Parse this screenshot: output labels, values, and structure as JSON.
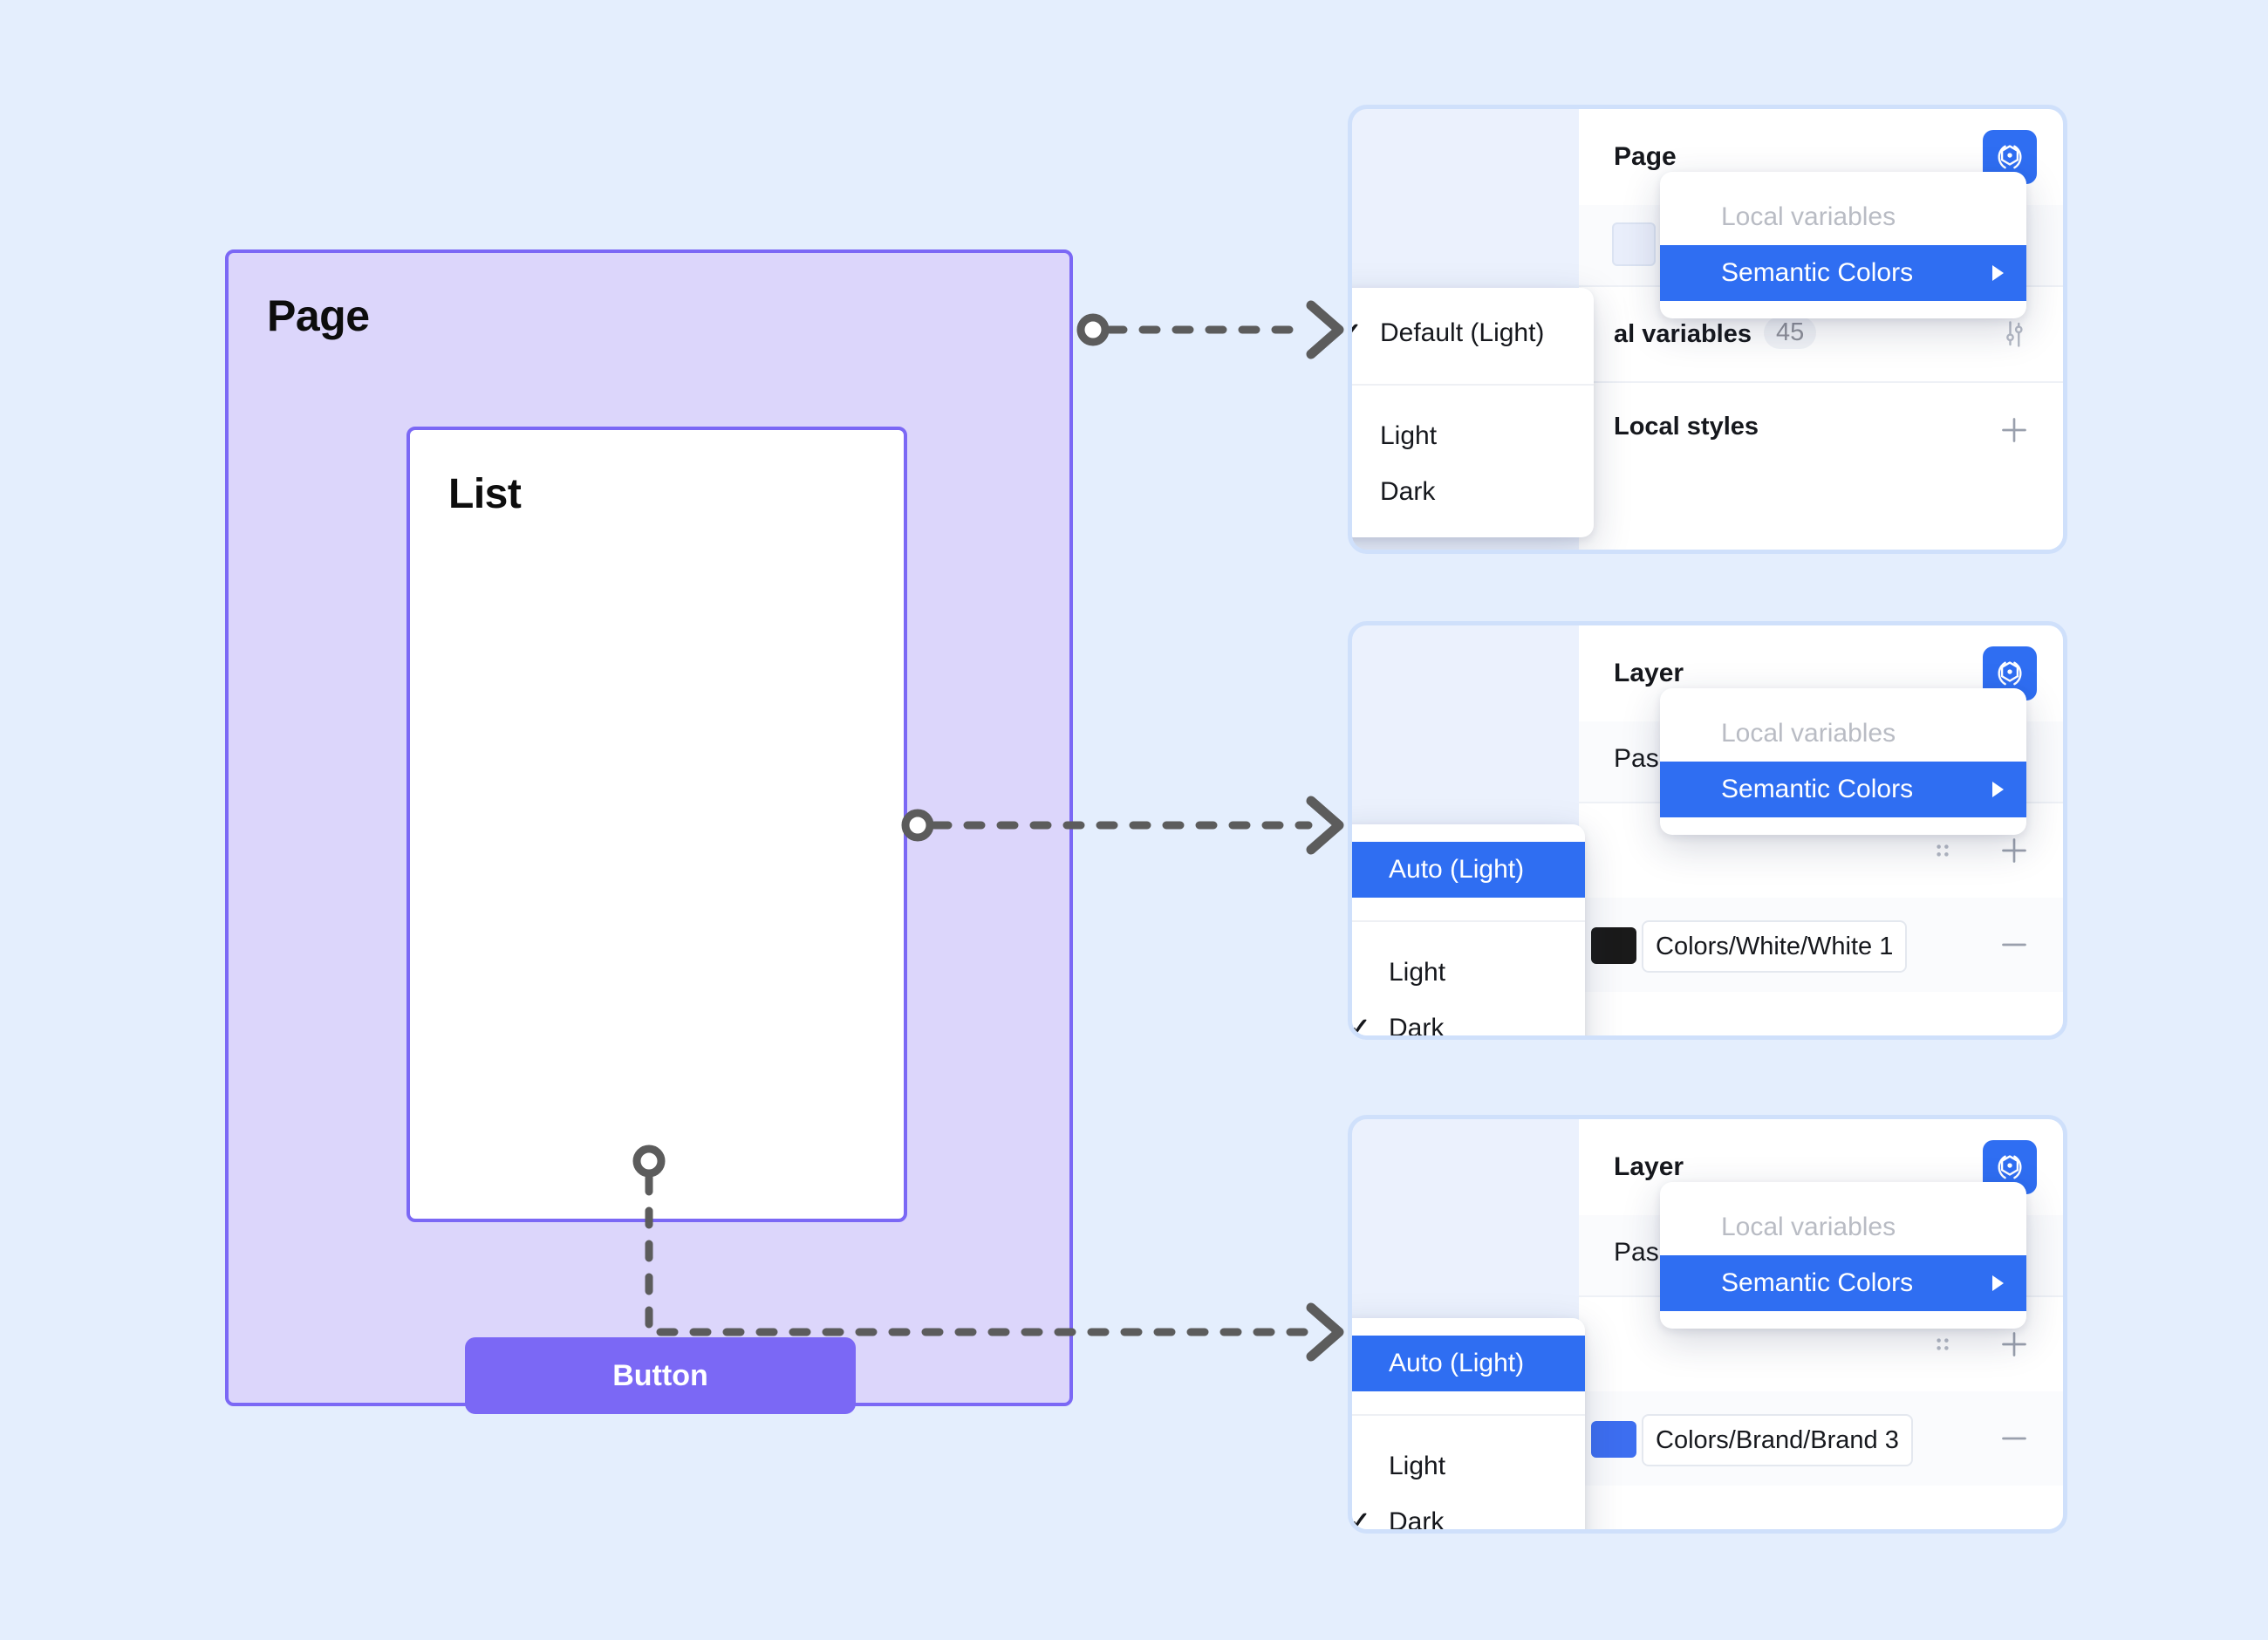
{
  "theme": {
    "background": "#e4eefd",
    "frame_purple": "#7b68f5",
    "frame_fill": "#dcd6fb",
    "accent_blue": "#2f6ef2",
    "panel_border": "#cfe0fb",
    "panel_fill": "#ebf1fd",
    "connector": "#5c5c5c"
  },
  "canvas": {
    "page_frame": {
      "title": "Page"
    },
    "list_frame": {
      "title": "List"
    },
    "button": {
      "label": "Button"
    }
  },
  "panels": [
    {
      "id": "page-panel",
      "title": "Page",
      "variables_icon": "variables-icon",
      "sub_label": "",
      "sections": [
        {
          "label": "Local variables",
          "truncated_label": "al variables",
          "count": "45",
          "icon": "sliders-icon"
        },
        {
          "label": "Local styles",
          "icon": "plus-icon"
        }
      ],
      "mode_menu": {
        "items": [
          {
            "label": "Default (Light)",
            "checked": true,
            "selected": false
          },
          {
            "label": "Light",
            "checked": false,
            "selected": false
          },
          {
            "label": "Dark",
            "checked": false,
            "selected": false
          }
        ]
      },
      "vars_menu": {
        "items": [
          {
            "label": "Local variables",
            "muted": true,
            "selected": false,
            "submenu": false
          },
          {
            "label": "Semantic Colors",
            "muted": false,
            "selected": true,
            "submenu": true
          }
        ]
      }
    },
    {
      "id": "layer-panel-white",
      "title": "Layer",
      "variables_icon": "variables-icon",
      "sub_label": "Pass through",
      "sub_label_visible": "Pas",
      "fill": {
        "name": "Colors/White/White 1",
        "swatch": "#1a1a1a"
      },
      "row_icons": {
        "drag": "drag-dots-icon",
        "add": "plus-icon",
        "remove": "minus-icon"
      },
      "mode_menu": {
        "items": [
          {
            "label": "Auto (Light)",
            "checked": false,
            "selected": true
          },
          {
            "label": "Light",
            "checked": false,
            "selected": false
          },
          {
            "label": "Dark",
            "checked": true,
            "selected": false
          }
        ]
      },
      "vars_menu": {
        "items": [
          {
            "label": "Local variables",
            "muted": true,
            "selected": false,
            "submenu": false
          },
          {
            "label": "Semantic Colors",
            "muted": false,
            "selected": true,
            "submenu": true
          }
        ]
      }
    },
    {
      "id": "layer-panel-brand",
      "title": "Layer",
      "variables_icon": "variables-icon",
      "sub_label": "Pass through",
      "sub_label_visible": "Pas",
      "fill": {
        "name": "Colors/Brand/Brand 3",
        "swatch": "#3d6ef0"
      },
      "row_icons": {
        "drag": "drag-dots-icon",
        "add": "plus-icon",
        "remove": "minus-icon"
      },
      "mode_menu": {
        "items": [
          {
            "label": "Auto (Light)",
            "checked": false,
            "selected": true
          },
          {
            "label": "Light",
            "checked": false,
            "selected": false
          },
          {
            "label": "Dark",
            "checked": true,
            "selected": false
          }
        ]
      },
      "vars_menu": {
        "items": [
          {
            "label": "Local variables",
            "muted": true,
            "selected": false,
            "submenu": false
          },
          {
            "label": "Semantic Colors",
            "muted": false,
            "selected": true,
            "submenu": true
          }
        ]
      }
    }
  ]
}
